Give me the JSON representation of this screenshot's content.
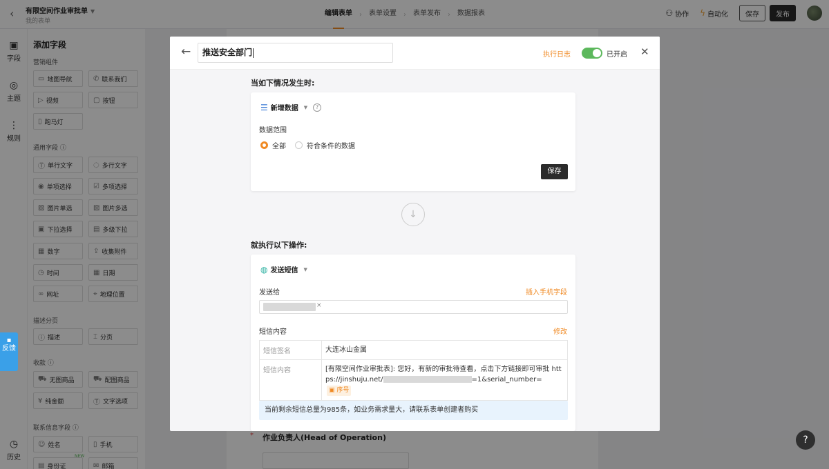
{
  "header": {
    "form_title": "有限空间作业审批单",
    "form_subtitle": "我的表单",
    "tabs": [
      "编辑表单",
      "表单设置",
      "表单发布",
      "数据报表"
    ],
    "collaborate": "协作",
    "automation": "自动化",
    "save": "保存",
    "publish": "发布"
  },
  "rail": {
    "fields": "字段",
    "theme": "主题",
    "rules": "规则",
    "history": "历史",
    "feedback": "反馈"
  },
  "panel": {
    "title": "添加字段",
    "sections": {
      "marketing": "营销组件",
      "common": "通用字段",
      "paging": "描述分页",
      "payment": "收款",
      "contact": "联系信息字段"
    },
    "marketing_items": [
      "地图导航",
      "联系我们",
      "视频",
      "按钮",
      "跑马灯"
    ],
    "common_items": [
      "单行文字",
      "多行文字",
      "单项选择",
      "多项选择",
      "图片单选",
      "图片多选",
      "下拉选择",
      "多级下拉",
      "数字",
      "收集附件",
      "时间",
      "日期",
      "网址",
      "地理位置"
    ],
    "paging_items": [
      "描述",
      "分页"
    ],
    "payment_items": [
      "无图商品",
      "配图商品",
      "纯金额",
      "文字选项"
    ],
    "contact_items": [
      "姓名",
      "手机",
      "身份证",
      "邮箱"
    ],
    "new_badge": "NEW"
  },
  "background_form": {
    "field_label": "作业负责人(Head of Operation)",
    "required_mark": "*"
  },
  "modal": {
    "name": "推送安全部门",
    "exec_log": "执行日志",
    "enabled_label": "已开启",
    "trigger_title": "当如下情况发生时:",
    "trigger_type": "新增数据",
    "data_scope_label": "数据范围",
    "scope_all": "全部",
    "scope_filtered": "符合条件的数据",
    "save": "保存",
    "action_title": "就执行以下操作:",
    "action_type": "发送短信",
    "send_to_label": "发送给",
    "insert_phone_field": "插入手机字段",
    "sms_content_label": "短信内容",
    "edit": "修改",
    "sms_sign_key": "短信签名",
    "sms_sign_value": "大连冰山金属",
    "sms_body_key": "短信内容",
    "sms_body_prefix": "[有限空间作业审批表]: 您好，有新的审批待查看，点击下方链接即可审批 https://jinshuju.net/",
    "sms_body_suffix": "=1&serial_number=",
    "seq_tag": "序号",
    "notice": "当前剩余短信总量为985条，如业务需求量大，请联系表单创建者购买"
  }
}
